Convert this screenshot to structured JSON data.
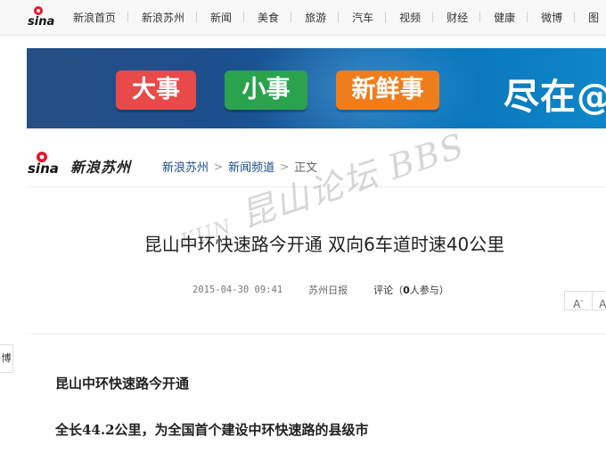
{
  "brand": {
    "logo_text": "sina"
  },
  "topnav": {
    "items": [
      "新浪首页",
      "新浪苏州",
      "新闻",
      "美食",
      "旅游",
      "汽车",
      "视频",
      "财经",
      "健康",
      "微博",
      "图"
    ]
  },
  "banner": {
    "pill1": "大事",
    "pill2": "小事",
    "pill3": "新鲜事",
    "tail": "尽在@"
  },
  "channel": {
    "name": "新浪苏州",
    "breadcrumb": [
      "新浪苏州",
      "新闻频道",
      "正文"
    ]
  },
  "watermark": {
    "text": "昆山论坛",
    "suffix": "BBS",
    "prefix": "KUN"
  },
  "article": {
    "title": "昆山中环快速路今开通 双向6车道时速40公里",
    "date": "2015-04-30 09:41",
    "source": "苏州日报",
    "comment_label": "评论",
    "comment_count": "0",
    "comment_suffix": "人参与",
    "paragraphs": [
      "昆山中环快速路今开通",
      "全长44.2公里，为全国首个建设中环快速路的县级市"
    ]
  },
  "font_controls": {
    "decrease": "A",
    "increase": "A"
  },
  "side_tab": "博"
}
